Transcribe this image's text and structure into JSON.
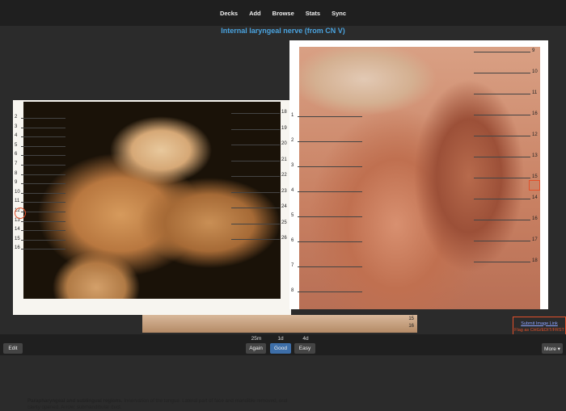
{
  "topbar": {
    "items": [
      "Decks",
      "Add",
      "Browse",
      "Stats",
      "Sync"
    ]
  },
  "card": {
    "title": "Internal laryngeal nerve (from CN V)"
  },
  "left_figure": {
    "left_labels": [
      "2",
      "3",
      "4",
      "5",
      "6",
      "7",
      "8",
      "9",
      "10",
      "11",
      "12",
      "13",
      "14",
      "15",
      "16"
    ],
    "right_labels": [
      "18",
      "19",
      "20",
      "21",
      "22",
      "23",
      "24",
      "25",
      "26"
    ],
    "caption_title": "Parapharyngeal and sublingual regions.",
    "caption_text": " Innervation of the tongue. Lateral part of face and mandible removed, oral cavity opened. Arrow: submandibular duct."
  },
  "right_figure": {
    "left_labels": [
      "1",
      "2",
      "3",
      "4",
      "5",
      "6",
      "7",
      "8"
    ],
    "right_labels": [
      "9",
      "10",
      "11",
      "16",
      "12",
      "13",
      "15",
      "14",
      "16",
      "17",
      "18"
    ]
  },
  "bottom_strip": {
    "labels": [
      "15",
      "16"
    ]
  },
  "report": {
    "link": "Submit Image Link",
    "sub": "Flag as CHG/EDIT/FRST"
  },
  "buttons": {
    "edit": "Edit",
    "again": "Again",
    "good": "Good",
    "easy": "Easy",
    "more": "More ▾"
  },
  "ease": {
    "again": "25m",
    "good": "1d",
    "easy": "4d"
  },
  "colors": {
    "accent": "#4aa3df",
    "marker": "#e2502a",
    "good_button": "#3d6ea8"
  }
}
